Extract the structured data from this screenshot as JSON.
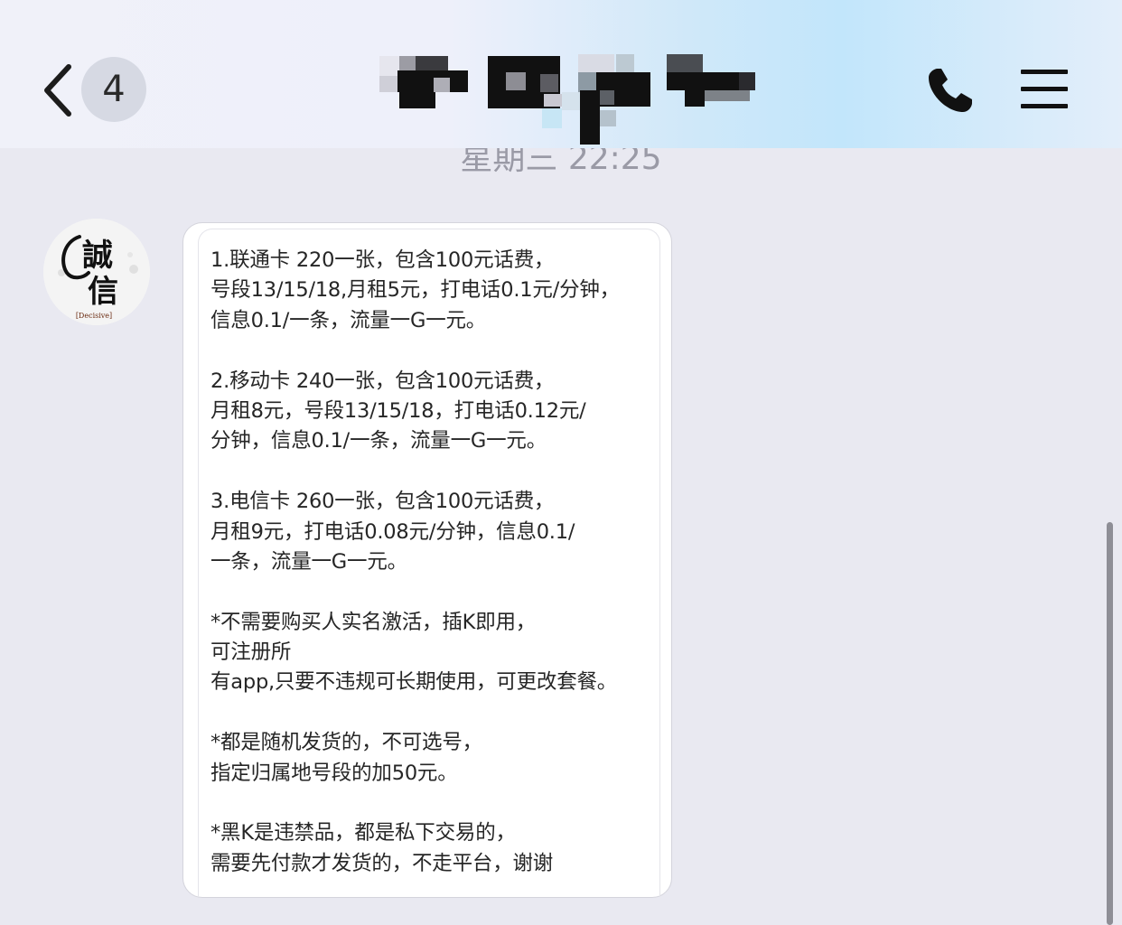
{
  "header": {
    "unread_count": "4",
    "contact_name": "",
    "contact_name_redacted": true
  },
  "timestamp": "星期三 22:25",
  "avatar": {
    "logo_text_1": "誠",
    "logo_text_2": "信",
    "logo_caption": "[Decisive]"
  },
  "message": {
    "lines": [
      "1.联通卡 220一张，包含100元话费，",
      "号段13/15/18,月租5元，打电话0.1元/分钟，",
      "信息0.1/一条，流量一G一元。",
      "",
      "2.移动卡 240一张，包含100元话费，",
      "月租8元，号段13/15/18，打电话0.12元/",
      "分钟，信息0.1/一条，流量一G一元。",
      "",
      "3.电信卡 260一张，包含100元话费，",
      "月租9元，打电话0.08元/分钟，信息0.1/",
      "一条，流量一G一元。",
      "",
      "*不需要购买人实名激活，插K即用，",
      "可注册所",
      "有app,只要不违规可长期使用，可更改套餐。",
      "",
      "*都是随机发货的，不可选号，",
      "指定归属地号段的加50元。",
      "",
      "*黑K是违禁品，都是私下交易的，",
      "需要先付款才发货的，不走平台，谢谢"
    ]
  },
  "icons": {
    "back": "chevron-left-icon",
    "call": "phone-icon",
    "menu": "hamburger-menu-icon"
  },
  "colors": {
    "background": "#e9e9f1",
    "bubble": "#ffffff",
    "badge": "#d6d9e3",
    "header_gradient_accent": "#c2e6fb"
  }
}
